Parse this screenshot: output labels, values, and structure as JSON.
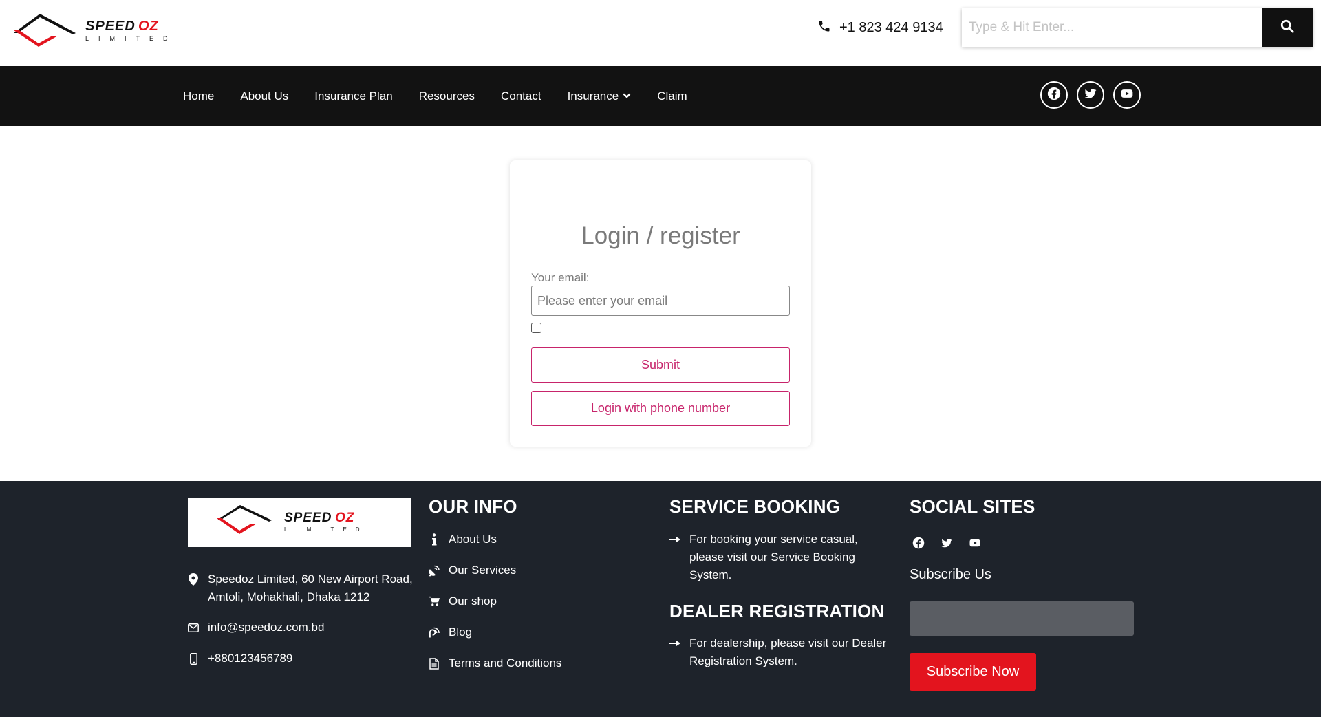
{
  "header": {
    "logo": {
      "brand": "SPEEDOZ",
      "subtitle": "LIMITED"
    },
    "phone": "+1 823 424 9134",
    "search": {
      "placeholder": "Type & Hit Enter..."
    }
  },
  "nav": {
    "items": [
      {
        "label": "Home"
      },
      {
        "label": "About Us"
      },
      {
        "label": "Insurance Plan"
      },
      {
        "label": "Resources"
      },
      {
        "label": "Contact"
      },
      {
        "label": "Insurance",
        "dropdown": true
      },
      {
        "label": "Claim"
      }
    ],
    "social_icons": [
      "facebook-icon",
      "twitter-icon",
      "youtube-icon"
    ]
  },
  "login": {
    "title": "Login / register",
    "email_label": "Your email:",
    "email_placeholder": "Please enter your email",
    "submit_label": "Submit",
    "phone_login_label": "Login with phone number",
    "accent_color": "#c7246b"
  },
  "footer": {
    "address": "Speedoz Limited, 60 New Airport Road, Amtoli, Mohakhali, Dhaka 1212",
    "email": "info@speedoz.com.bd",
    "phone": "+880123456789",
    "our_info": {
      "heading": "OUR INFO",
      "links": [
        {
          "label": "About Us",
          "icon": "info-icon"
        },
        {
          "label": "Our Services",
          "icon": "satellite-dish-icon"
        },
        {
          "label": "Our shop",
          "icon": "cart-icon"
        },
        {
          "label": "Blog",
          "icon": "blog-icon"
        },
        {
          "label": "Terms and Conditions",
          "icon": "document-icon"
        }
      ]
    },
    "service_booking": {
      "heading": "SERVICE BOOKING",
      "text": "For booking your service casual, please visit our Service Booking System."
    },
    "dealer_registration": {
      "heading": "DEALER REGISTRATION",
      "text": "For dealership, please visit our Dealer Registration System."
    },
    "social": {
      "heading": "SOCIAL SITES",
      "subscribe_label": "Subscribe Us",
      "subscribe_button": "Subscribe Now",
      "button_color": "#e3141e"
    }
  }
}
